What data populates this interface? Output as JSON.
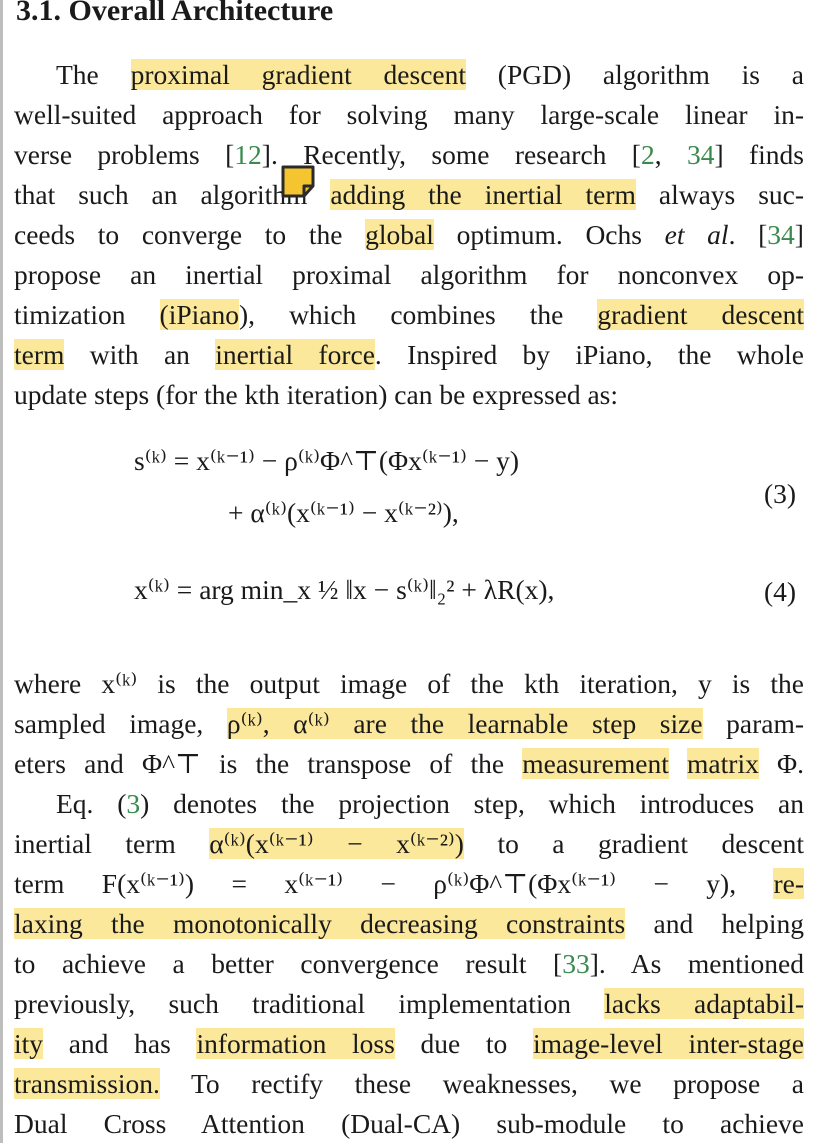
{
  "heading": "3.1. Overall Architecture",
  "para1": {
    "l1": {
      "a": "The ",
      "b": "proximal gradient descent",
      "c": " (PGD) algorithm is a"
    },
    "l2": "well-suited approach for solving many large-scale linear in-",
    "l3": {
      "a": "verse problems [",
      "r1": "12",
      "b": "]. Recently, some research [",
      "r2": "2",
      "c": ", ",
      "r3": "34",
      "d": "] finds"
    },
    "l4": {
      "a": "that such an algorithm ",
      "b": "adding the inertial term",
      "c": " always suc-"
    },
    "l5": {
      "a": "ceeds to converge to the ",
      "b": "global",
      "c": " optimum. Ochs ",
      "d": "et al",
      "e": ". [",
      "r": "34",
      "f": "]"
    },
    "l6": "propose an inertial proximal algorithm for nonconvex op-",
    "l7": {
      "a": "timization ",
      "b": "(iPiano",
      "c": "), which combines the ",
      "d": "gradient descent"
    },
    "l8": {
      "a": "term",
      "b": " with an ",
      "c": "inertial force",
      "d": ". Inspired by iPiano, the whole"
    },
    "l9": "update steps (for the kth iteration) can be expressed as:"
  },
  "equations": {
    "eq3_line1": "s⁽ᵏ⁾ = x⁽ᵏ⁻¹⁾ − ρ⁽ᵏ⁾Φ^⊤(Φx⁽ᵏ⁻¹⁾ − y)",
    "eq3_line2": "+ α⁽ᵏ⁾(x⁽ᵏ⁻¹⁾ − x⁽ᵏ⁻²⁾),",
    "eq4": "x⁽ᵏ⁾ = arg min_x ½ ‖x − s⁽ᵏ⁾‖₂² + λR(x),",
    "num3": "(3)",
    "num4": "(4)"
  },
  "para2": {
    "l1": "where x⁽ᵏ⁾ is the output image of the kth iteration, y is the",
    "l2": {
      "a": "sampled image, ",
      "b": "ρ⁽ᵏ⁾, α⁽ᵏ⁾ are the learnable step size",
      "c": " param-"
    },
    "l3": {
      "a": "eters and Φ^⊤ is the transpose of the ",
      "b": "measurement",
      "c": " ",
      "d": "matrix",
      "e": " Φ."
    }
  },
  "para3": {
    "l1": {
      "a": "Eq. (",
      "r": "3",
      "b": ") denotes the projection step, which introduces an"
    },
    "l2": {
      "a": "inertial term ",
      "b": "α⁽ᵏ⁾(x⁽ᵏ⁻¹⁾ − x⁽ᵏ⁻²⁾)",
      "c": " to a gradient descent"
    },
    "l3": {
      "a": "term F(x⁽ᵏ⁻¹⁾) = x⁽ᵏ⁻¹⁾ − ρ⁽ᵏ⁾Φ^⊤(Φx⁽ᵏ⁻¹⁾ − y), ",
      "b": "re-"
    },
    "l4": {
      "a": "laxing the monotonically decreasing constraints",
      "b": " and helping"
    },
    "l5": {
      "a": "to achieve a better convergence result [",
      "r": "33",
      "b": "]. As mentioned"
    },
    "l6": {
      "a": "previously, such traditional implementation ",
      "b": "lacks adaptabil-"
    },
    "l7": {
      "a": "ity",
      "b": " and has ",
      "c": "information loss",
      "d": " due to ",
      "e": "image-level inter-stage"
    },
    "l8": {
      "a": "transmission.",
      "b": " To rectify these weaknesses, we propose a"
    },
    "l9": "Dual Cross Attention (Dual-CA) sub-module to achieve"
  },
  "colors": {
    "highlight": "#fbe89a",
    "reference": "#3a8a4f",
    "note_icon": "#f5c531"
  }
}
